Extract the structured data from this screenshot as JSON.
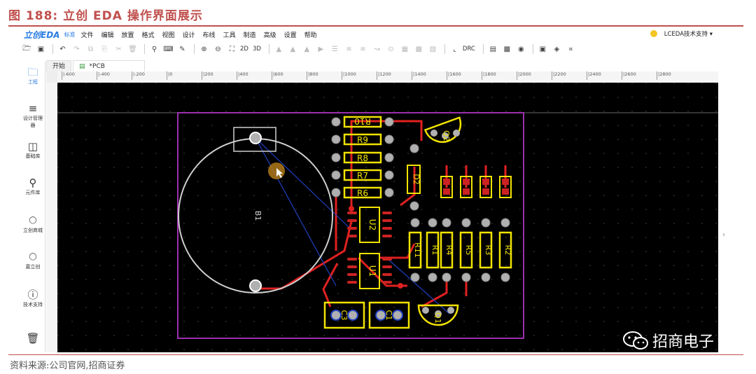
{
  "figure": {
    "title": "图 188:  立创 EDA 操作界面展示",
    "source": "资料来源:公司官网,招商证券"
  },
  "app": {
    "logo": "立创EDA",
    "logo_tag": "标准",
    "menus": [
      "文件",
      "编辑",
      "放置",
      "格式",
      "视图",
      "设计",
      "布线",
      "工具",
      "制造",
      "高级",
      "设置",
      "帮助"
    ],
    "support": "LCEDA技术支持 ▾",
    "toolbar_text": {
      "view2d": "2D",
      "view3d": "3D",
      "drc": "DRC"
    }
  },
  "sidebar": [
    {
      "icon": "folder-icon",
      "label": "工程"
    },
    {
      "icon": "design-manager-icon",
      "label": "设计管理器"
    },
    {
      "icon": "chip-icon",
      "label": "基础库"
    },
    {
      "icon": "search-part-icon",
      "label": "元件库"
    },
    {
      "icon": "lcsc-icon",
      "label": "立创商城"
    },
    {
      "icon": "jlc-icon",
      "label": "嘉立创"
    },
    {
      "icon": "help-icon",
      "label": "技术支持"
    },
    {
      "icon": "trash-icon",
      "label": ""
    }
  ],
  "tabs": [
    {
      "label": "开始"
    },
    {
      "label": "*PCB"
    }
  ],
  "ruler": {
    "ticks": [
      "|-600",
      "|-400",
      "|-200",
      "|0",
      "|200",
      "|400",
      "|600",
      "|800",
      "|1000",
      "|1200",
      "|1400",
      "|1600",
      "|1800",
      "|2000",
      "|2200",
      "|2400",
      "|2600",
      "|2800"
    ]
  },
  "pcb": {
    "battery_label": "B1",
    "resistors_left": [
      "R10",
      "R9",
      "R8",
      "R7",
      "R6"
    ],
    "resistors_right": [
      "R11",
      "R1",
      "R4",
      "R5",
      "R3",
      "R2"
    ],
    "ics": [
      "U2",
      "U1"
    ],
    "diode": "D2",
    "transistors": [
      "Q2",
      "Q1"
    ],
    "bottom_parts": [
      "C3",
      "C1"
    ],
    "colors": {
      "board_outline": "#9b2fae",
      "silkscreen": "#f2e300",
      "pad": "#cc2222",
      "track": "#e02020",
      "track_bottom": "#2040c0",
      "hole": "#b0b0b0"
    }
  },
  "watermark": "招商电子"
}
